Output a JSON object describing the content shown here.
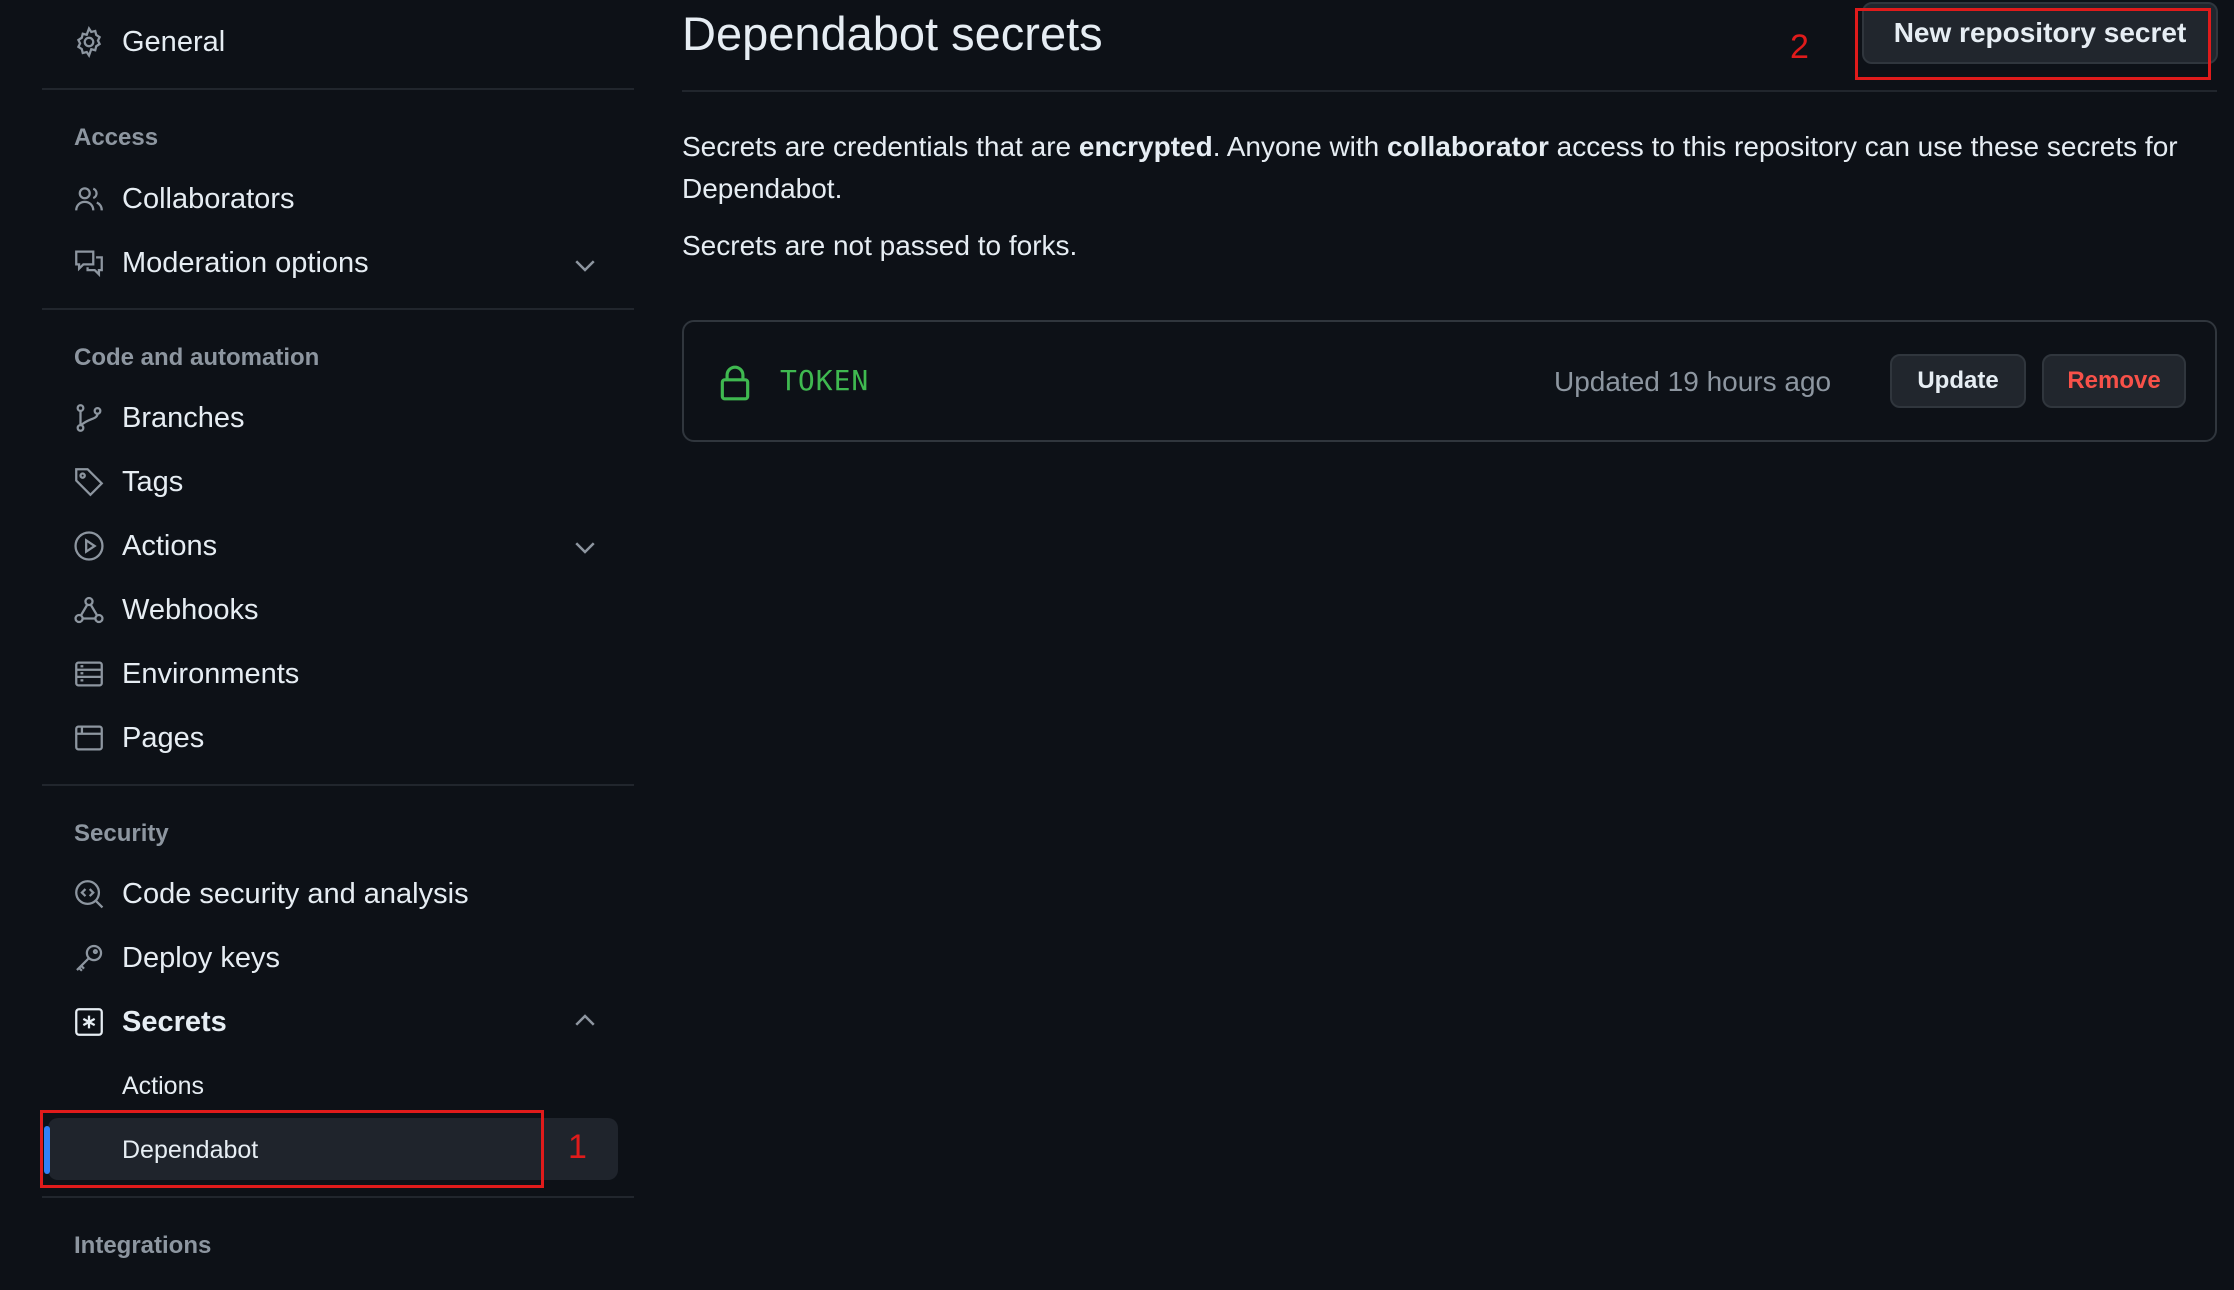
{
  "sidebar": {
    "general": "General",
    "sections": {
      "access": "Access",
      "code_automation": "Code and automation",
      "security": "Security",
      "integrations": "Integrations"
    },
    "items": {
      "collaborators": "Collaborators",
      "moderation": "Moderation options",
      "branches": "Branches",
      "tags": "Tags",
      "actions": "Actions",
      "webhooks": "Webhooks",
      "environments": "Environments",
      "pages": "Pages",
      "code_security": "Code security and analysis",
      "deploy_keys": "Deploy keys",
      "secrets": "Secrets"
    },
    "secrets_sub": {
      "actions": "Actions",
      "dependabot": "Dependabot"
    }
  },
  "main": {
    "title": "Dependabot secrets",
    "new_button": "New repository secret",
    "desc_1": "Secrets are credentials that are ",
    "desc_bold_1": "encrypted",
    "desc_2": ". Anyone with ",
    "desc_bold_2": "collaborator",
    "desc_3": " access to this repository can use these secrets for Dependabot.",
    "note": "Secrets are not passed to forks.",
    "secret": {
      "name": "TOKEN",
      "updated": "Updated 19 hours ago",
      "update_label": "Update",
      "remove_label": "Remove"
    }
  },
  "annotations": {
    "one": "1",
    "two": "2"
  },
  "colors": {
    "background": "#0d1117",
    "accent_blue": "#2f81f7",
    "secret_green": "#3fb950",
    "danger_red": "#f85149",
    "annotation_red": "#e01b1b"
  }
}
